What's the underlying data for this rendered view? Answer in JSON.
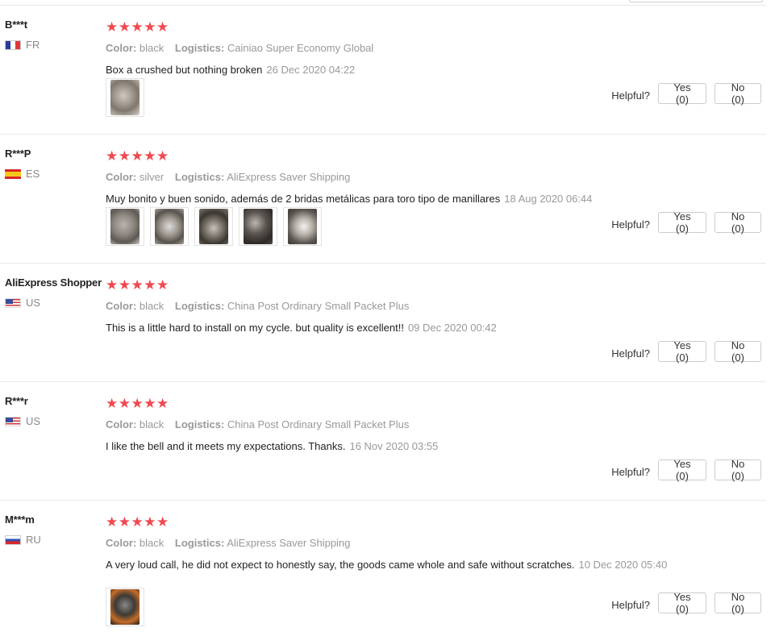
{
  "labels": {
    "color": "Color:",
    "logistics": "Logistics:",
    "helpful": "Helpful?",
    "yes": "Yes (0)",
    "no": "No (0)"
  },
  "stars": "★★★★★",
  "reviews": [
    {
      "user": "B***t",
      "country": "FR",
      "rating": 5,
      "color": "black",
      "logistics": "Cainiao Super Economy Global",
      "text": "Box a crushed but nothing broken",
      "date": "26 Dec 2020 04:22",
      "photos": 1
    },
    {
      "user": "R***P",
      "country": "ES",
      "rating": 5,
      "color": "silver",
      "logistics": "AliExpress Saver Shipping",
      "text": "Muy bonito y buen sonido, además de 2 bridas metálicas para toro tipo de manillares",
      "date": "18 Aug 2020 06:44",
      "photos": 5
    },
    {
      "user": "AliExpress Shopper",
      "country": "US",
      "rating": 5,
      "color": "black",
      "logistics": "China Post Ordinary Small Packet Plus",
      "text": "This is a little hard to install on my cycle. but quality is excellent!!",
      "date": "09 Dec 2020 00:42",
      "photos": 0
    },
    {
      "user": "R***r",
      "country": "US",
      "rating": 5,
      "color": "black",
      "logistics": "China Post Ordinary Small Packet Plus",
      "text": "I like the bell and it meets my expectations. Thanks.",
      "date": "16 Nov 2020 03:55",
      "photos": 0
    },
    {
      "user": "M***m",
      "country": "RU",
      "rating": 5,
      "color": "black",
      "logistics": "AliExpress Saver Shipping",
      "text": "A very loud call, he did not expect to honestly say, the goods came whole and safe without scratches.",
      "date": "10 Dec 2020 05:40",
      "photos": 1
    }
  ]
}
